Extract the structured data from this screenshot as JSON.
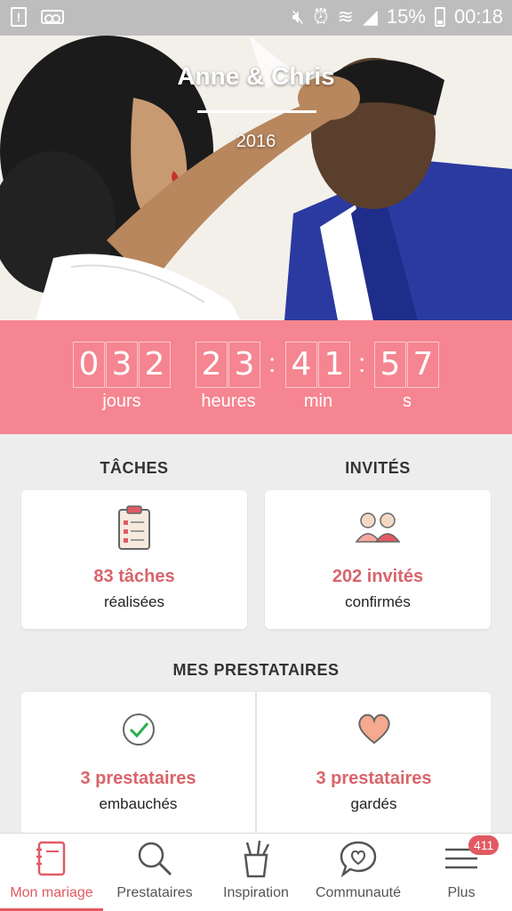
{
  "status_bar": {
    "battery": "15%",
    "time": "00:18"
  },
  "hero": {
    "names": "Anne & Chris",
    "date": "2016"
  },
  "countdown": {
    "days_digits": [
      "0",
      "3",
      "2"
    ],
    "hours_digits": [
      "2",
      "3"
    ],
    "minutes_digits": [
      "4",
      "1"
    ],
    "seconds_digits": [
      "5",
      "7"
    ],
    "colon": ":",
    "labels": {
      "days": "jours",
      "hours": "heures",
      "minutes": "min",
      "seconds": "s"
    }
  },
  "tasks": {
    "title": "TÂCHES",
    "count": "83 tâches",
    "sub": "réalisées"
  },
  "guests": {
    "title": "INVITÉS",
    "count": "202 invités",
    "sub": "confirmés"
  },
  "vendors": {
    "title": "MES PRESTATAIRES",
    "hired": {
      "count": "3 prestataires",
      "sub": "embauchés"
    },
    "saved": {
      "count": "3 prestataires",
      "sub": "gardés"
    }
  },
  "bottom_nav": {
    "items": [
      {
        "label": "Mon mariage",
        "icon": "notebook-icon"
      },
      {
        "label": "Prestataires",
        "icon": "search-icon"
      },
      {
        "label": "Inspiration",
        "icon": "tools-cup-icon"
      },
      {
        "label": "Communauté",
        "icon": "chat-heart-icon"
      },
      {
        "label": "Plus",
        "icon": "menu-icon"
      }
    ],
    "badge": "411"
  },
  "colors": {
    "accent": "#e15a63",
    "countdown_bg": "#f58590",
    "status_bar": "#bdbdbd"
  }
}
